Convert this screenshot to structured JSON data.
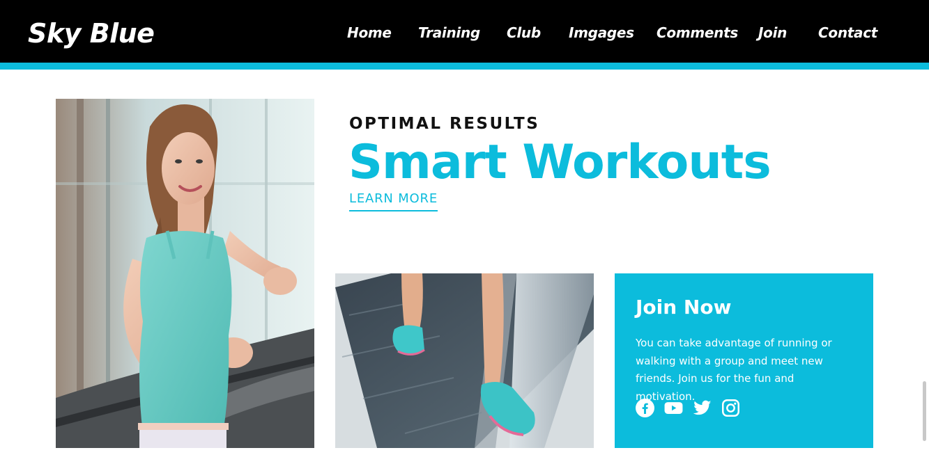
{
  "header": {
    "logo": "Sky Blue",
    "nav": [
      "Home",
      "Training",
      "Club",
      "Imgages",
      "Comments",
      "Join",
      "Contact"
    ]
  },
  "hero": {
    "kicker": "OPTIMAL RESULTS",
    "headline": "Smart Workouts",
    "cta": "LEARN MORE"
  },
  "join": {
    "title": "Join Now",
    "text": "You can take advantage of running or walking with a group and meet new friends. Join us for the fun and motivation.",
    "social_icons": [
      "facebook-icon",
      "youtube-icon",
      "twitter-icon",
      "instagram-icon"
    ]
  },
  "colors": {
    "accent": "#0cbcdc",
    "nav_bg": "#000000"
  }
}
